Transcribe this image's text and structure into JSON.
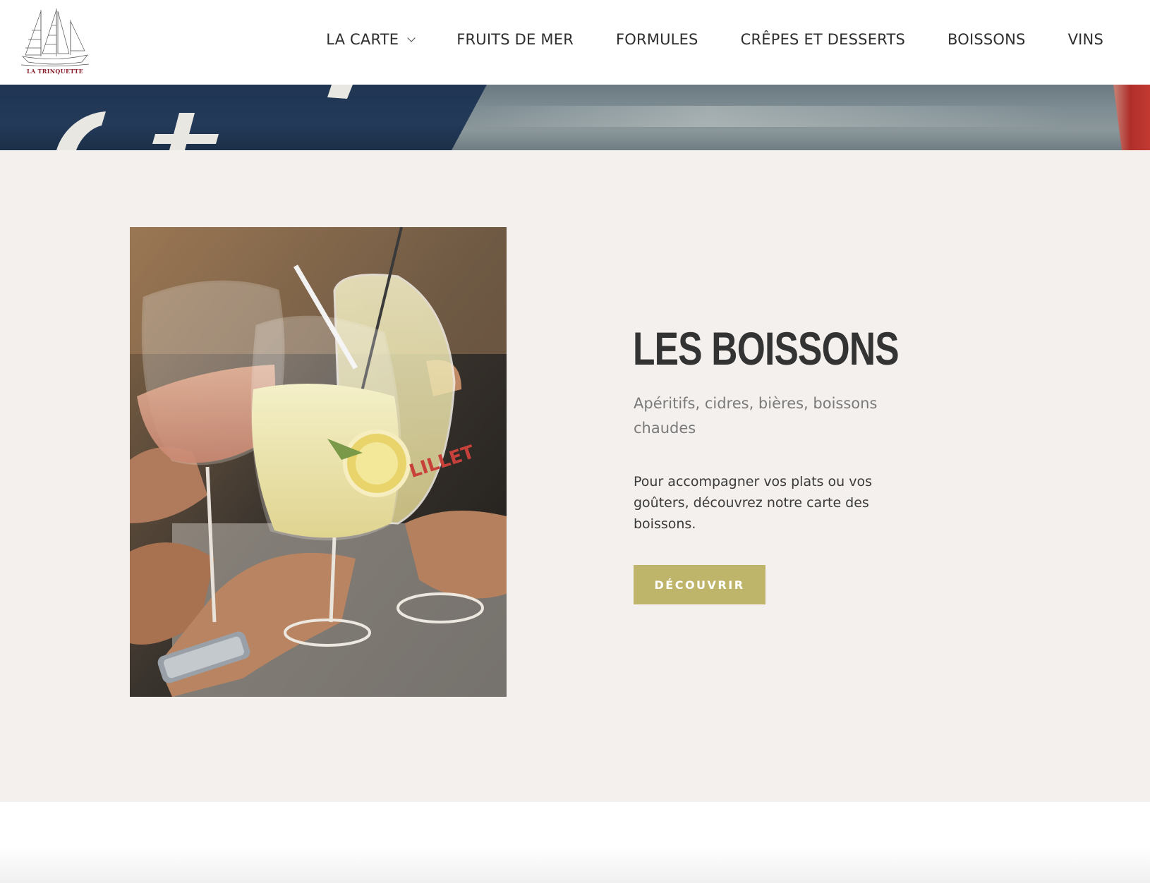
{
  "header": {
    "logo_text": "LA TRINQUETTE",
    "nav": [
      {
        "label": "LA CARTE",
        "has_dropdown": true
      },
      {
        "label": "FRUITS DE MER"
      },
      {
        "label": "FORMULES"
      },
      {
        "label": "CRÊPES ET DESSERTS"
      },
      {
        "label": "BOISSONS"
      },
      {
        "label": "VINS"
      }
    ]
  },
  "main": {
    "title": "LES BOISSONS",
    "subtitle": "Apéritifs, cidres, bières, boissons chaudes",
    "description": "Pour accompagner vos plats ou vos goûters, découvrez notre carte des boissons.",
    "button_label": "DÉCOUVRIR",
    "photo_glass_brand": "LILLET"
  },
  "colors": {
    "accent": "#bfb56a",
    "section_bg": "#f4f0ed",
    "text_dark": "#333333",
    "text_muted": "#7a7a7a",
    "logo_red": "#8a1e2a"
  }
}
